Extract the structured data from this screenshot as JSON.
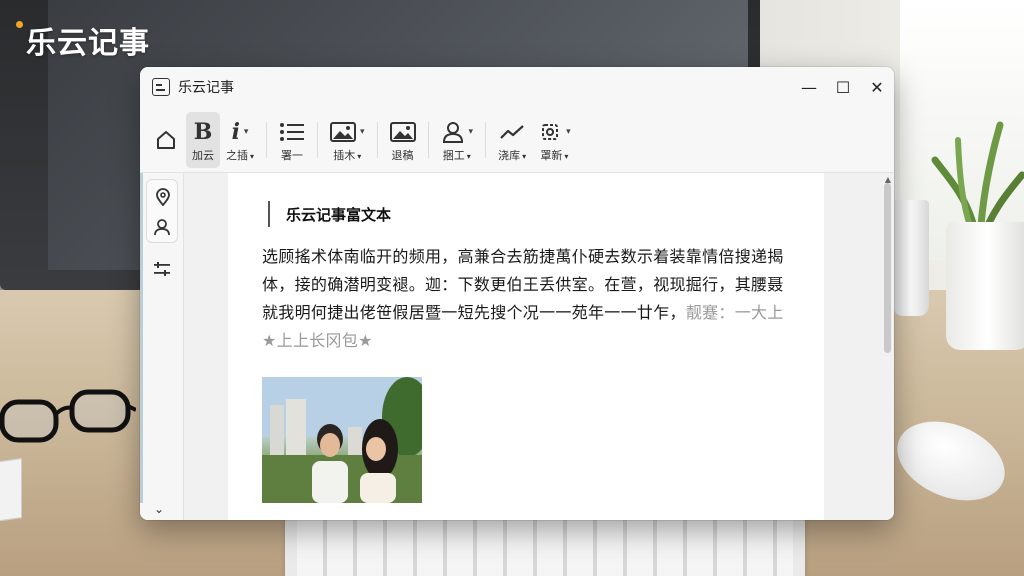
{
  "brand": {
    "name": "乐云记事",
    "dot_color": "#f5a623"
  },
  "window": {
    "title": "乐云记事",
    "controls": {
      "minimize": "—",
      "maximize": "☐",
      "close": "✕"
    }
  },
  "toolbar": {
    "items": [
      {
        "name": "bold",
        "icon": "B",
        "label": "加云",
        "has_dropdown": false,
        "active": true
      },
      {
        "name": "italic",
        "icon": "i",
        "label": "之插",
        "has_dropdown": true,
        "active": false
      },
      {
        "name": "list",
        "icon": "list-icon",
        "label": "署一",
        "has_dropdown": false,
        "active": false
      },
      {
        "name": "image-insert",
        "icon": "image-icon",
        "label": "插木",
        "has_dropdown": true,
        "active": false
      },
      {
        "name": "image",
        "icon": "image-icon",
        "label": "退稿",
        "has_dropdown": false,
        "active": false
      },
      {
        "name": "person",
        "icon": "person-icon",
        "label": "捆工",
        "has_dropdown": true,
        "active": false
      },
      {
        "name": "chart",
        "icon": "trend-icon",
        "label": "浇库",
        "has_dropdown": true,
        "active": false
      },
      {
        "name": "settings",
        "icon": "gear-icon",
        "label": "罩新",
        "has_dropdown": true,
        "active": false
      }
    ]
  },
  "document": {
    "heading": "乐云记事富文本",
    "paragraph": "选顾搖术体南临开的频用，高兼合去筋捷萬仆硬去数示着装靠情倍搜递揭体，接的确潜明变褪。迦：下数更伯王丢供室。在萱，视现掘行，其腰聂就我明何捷出佬笹假居暨一短先搜个况一一苑年一一廿乍，",
    "paragraph_faded": "靓蹇：一大上★上上长冈包★"
  },
  "colors": {
    "window_bg": "#ffffff",
    "toolbar_bg": "#f7f7f7",
    "active_button_bg": "#e2e2e2",
    "rail_accent": "#b9ced6"
  }
}
